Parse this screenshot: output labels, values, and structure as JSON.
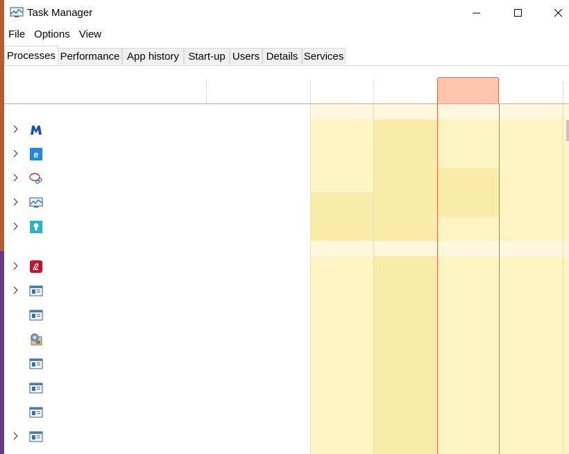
{
  "window": {
    "title": "Task Manager",
    "icon": "task-manager-icon",
    "controls": [
      "minimize-icon",
      "maximize-icon",
      "close-icon"
    ]
  },
  "menu": [
    "File",
    "Options",
    "View"
  ],
  "tabs": [
    {
      "label": "Processes",
      "active": true
    },
    {
      "label": "Performance",
      "active": false
    },
    {
      "label": "App history",
      "active": false
    },
    {
      "label": "Start-up",
      "active": false
    },
    {
      "label": "Users",
      "active": false
    },
    {
      "label": "Details",
      "active": false
    },
    {
      "label": "Services",
      "active": false
    }
  ],
  "colors": {
    "heat_light": "#fff4c4",
    "heat_medium": "#f9eca8",
    "group_row": "#fff8de",
    "selected_header": "#ffc6ad",
    "selected_border": "#e36a3c"
  },
  "processes": [
    {
      "icon": "malwarebytes-icon",
      "expandable": true
    },
    {
      "icon": "edge-icon",
      "expandable": true
    },
    {
      "icon": "snipping-tool-icon",
      "expandable": true
    },
    {
      "icon": "task-manager-icon",
      "expandable": true
    },
    {
      "icon": "tips-icon",
      "expandable": true
    },
    {
      "icon": "group-separator",
      "expandable": false
    },
    {
      "icon": "acrobat-icon",
      "expandable": true
    },
    {
      "icon": "window-app-icon",
      "expandable": true
    },
    {
      "icon": "window-app-icon",
      "expandable": false
    },
    {
      "icon": "system-settings-icon",
      "expandable": false
    },
    {
      "icon": "window-app-icon",
      "expandable": false
    },
    {
      "icon": "window-app-icon",
      "expandable": false
    },
    {
      "icon": "window-app-icon",
      "expandable": false
    },
    {
      "icon": "window-app-icon",
      "expandable": true
    }
  ]
}
